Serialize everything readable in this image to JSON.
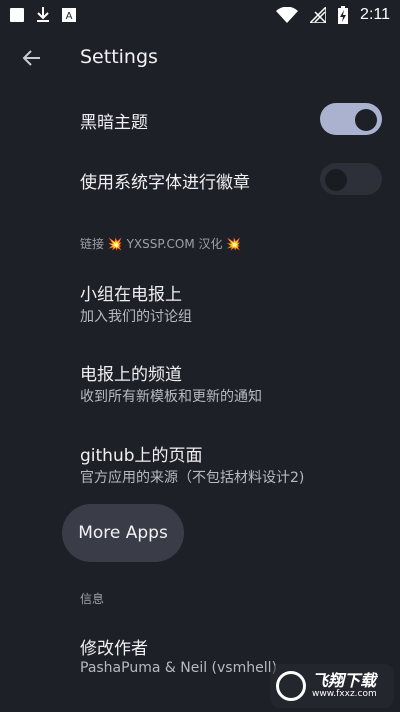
{
  "statusbar": {
    "time": "2:11",
    "icons_left": [
      "square-icon",
      "download-icon",
      "font-icon"
    ],
    "icons_right": [
      "wifi-icon",
      "signal-off-icon",
      "battery-charging-icon"
    ]
  },
  "appbar": {
    "title": "Settings"
  },
  "settings": {
    "dark_theme": {
      "label": "黑暗主题",
      "enabled": true
    },
    "system_font": {
      "label": "使用系统字体进行徽章",
      "enabled": false
    }
  },
  "links_section": {
    "label": "链接 💥 YXSSP.COM 汉化 💥"
  },
  "links": [
    {
      "title": "小组在电报上",
      "subtitle": "加入我们的讨论组"
    },
    {
      "title": "电报上的频道",
      "subtitle": "收到所有新模板和更新的通知"
    },
    {
      "title": "github上的页面",
      "subtitle": "官方应用的来源（不包括材料设计2)"
    }
  ],
  "more_apps": {
    "label": "More Apps"
  },
  "info_section": {
    "label": "信息"
  },
  "author": {
    "title": "修改作者",
    "subtitle": "PashaPuma & Neil (vsmhell)"
  },
  "watermark": {
    "cn": "飞翔下载",
    "en": "www.fxxz.com"
  },
  "colors": {
    "background": "#1e2027",
    "switch_on": "#aab2cf",
    "switch_off": "#2d3039",
    "pill": "#3a3d47"
  }
}
